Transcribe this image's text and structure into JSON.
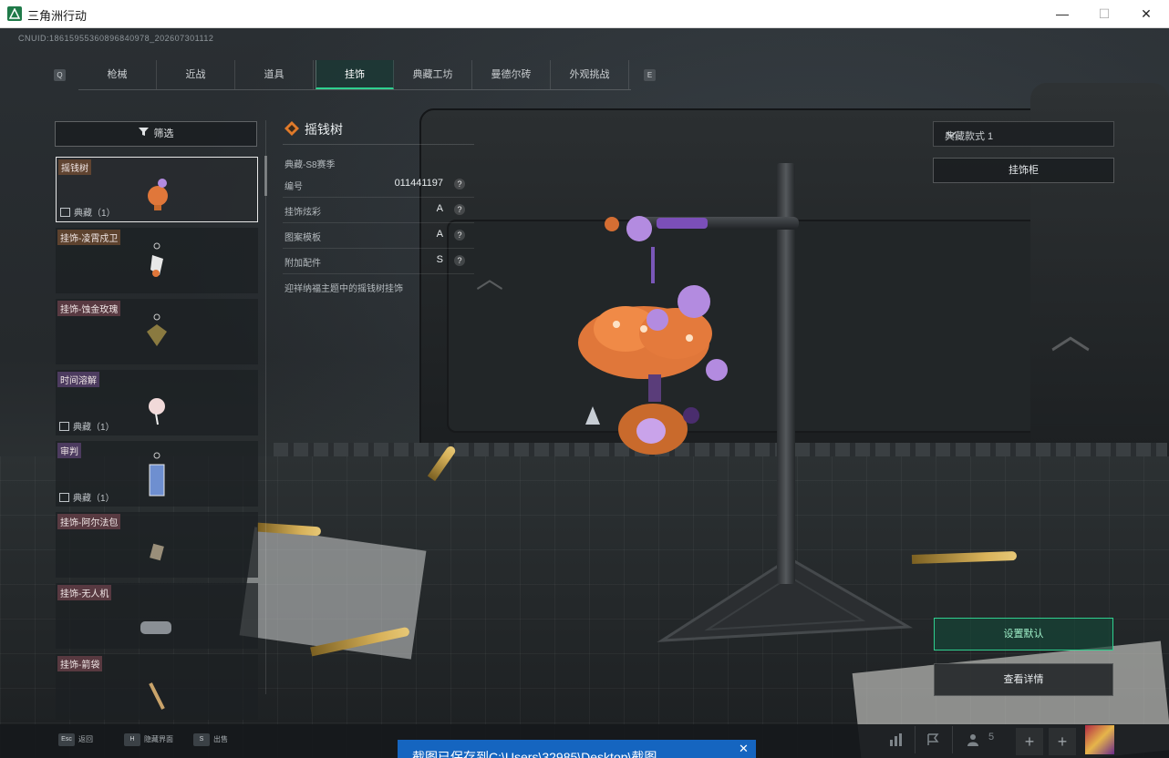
{
  "window": {
    "title": "三角洲行动",
    "minimize": "—",
    "maximize": "☐",
    "close": "✕"
  },
  "uid": "CNUID:18615955360896840978_202607301112",
  "tabs": {
    "left_key": "Q",
    "right_key": "E",
    "items": [
      "枪械",
      "近战",
      "道具",
      "挂饰",
      "典藏工坊",
      "曼德尔砖",
      "外观挑战"
    ],
    "active_index": 3
  },
  "filter": {
    "label": "筛选"
  },
  "list": {
    "items": [
      {
        "label": "摇钱树",
        "tag": "典藏（1）",
        "selected": true
      },
      {
        "label": "挂饰-凌霄戍卫",
        "tag": ""
      },
      {
        "label": "挂饰-蚀金玫瑰",
        "tag": ""
      },
      {
        "label": "时间溶解",
        "tag": "典藏（1）"
      },
      {
        "label": "审判",
        "tag": "典藏（1）"
      },
      {
        "label": "挂饰-阿尔法包",
        "tag": ""
      },
      {
        "label": "挂饰-无人机",
        "tag": ""
      },
      {
        "label": "挂饰-箭袋",
        "tag": ""
      }
    ]
  },
  "detail": {
    "title": "摇钱树",
    "season": "典藏-S8赛季",
    "rows": [
      {
        "key": "编号",
        "value": "011441197"
      },
      {
        "key": "挂饰炫彩",
        "value": "A"
      },
      {
        "key": "图案模板",
        "value": "A"
      },
      {
        "key": "附加配件",
        "value": "S"
      }
    ],
    "help_glyph": "?",
    "description": "迎祥纳福主题中的摇钱树挂饰"
  },
  "right_panel": {
    "style_select": "典藏款式 1",
    "rack_button": "挂饰柜",
    "default_button": "设置默认",
    "details_button": "查看详情"
  },
  "bottom": {
    "hints": [
      {
        "key": "Esc",
        "label": "返回"
      },
      {
        "key": "H",
        "label": "隐藏界面"
      },
      {
        "key": "S",
        "label": "出售"
      }
    ],
    "team_count": "5",
    "plus": "+"
  },
  "toast": {
    "text": "截图已保存到C:\\Users\\32985\\Desktop\\截图",
    "close": "✕"
  },
  "colors": {
    "accent": "#2fd08f",
    "toast": "#1565c0"
  }
}
